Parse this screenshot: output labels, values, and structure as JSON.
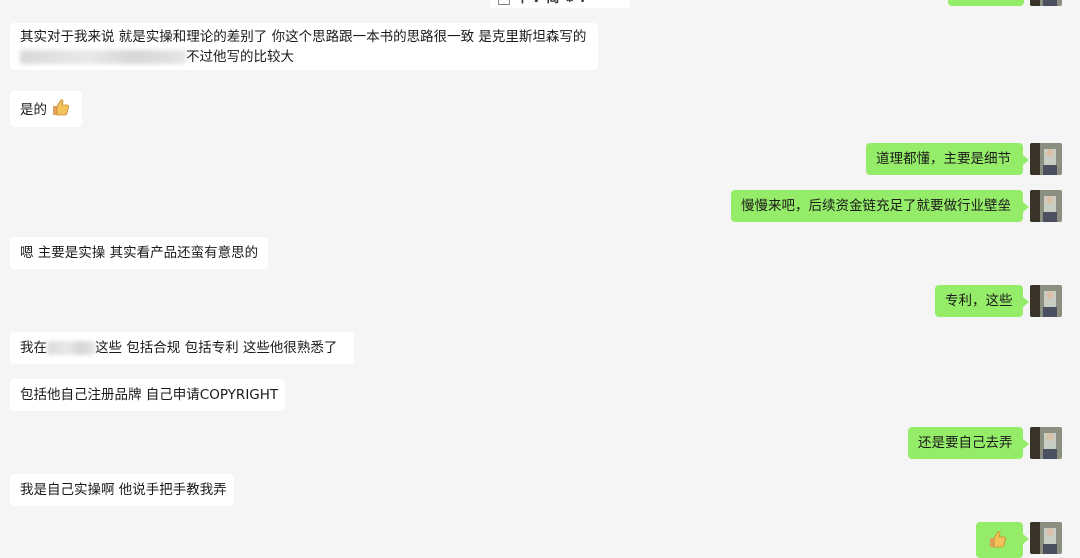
{
  "top_partial": {
    "text": "中 ♪ 简 ⚙ :"
  },
  "messages": [
    {
      "side": "in",
      "line1": "其实对于我来说 就是实操和理论的差别了 你这个思路跟一本书的思路很一致 是克里斯坦森写的",
      "line2_suffix": "不过他写的比较大"
    },
    {
      "side": "in",
      "text": "是的"
    },
    {
      "side": "out",
      "text": "道理都懂，主要是细节"
    },
    {
      "side": "out",
      "text": "慢慢来吧，后续资金链充足了就要做行业壁垒"
    },
    {
      "side": "in",
      "text": "嗯 主要是实操 其实看产品还蛮有意思的"
    },
    {
      "side": "out",
      "text": "专利，这些"
    },
    {
      "side": "in",
      "prefix": "我在",
      "suffix": "这些 包括合规 包括专利 这些他很熟悉了"
    },
    {
      "side": "in",
      "text": "包括他自己注册品牌 自己申请COPYRIGHT"
    },
    {
      "side": "out",
      "text": "还是要自己去弄"
    },
    {
      "side": "in",
      "text": "我是自己实操啊 他说手把手教我弄"
    }
  ],
  "icons": {
    "thumbs_up": "thumbs-up-emoji",
    "avatar": "user-avatar"
  },
  "colors": {
    "background": "#f5f5f5",
    "incoming_bubble": "#ffffff",
    "outgoing_bubble": "#95ec69"
  }
}
